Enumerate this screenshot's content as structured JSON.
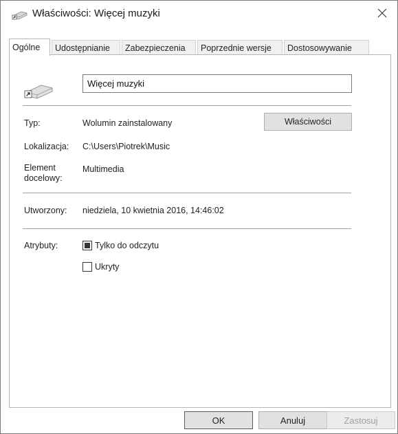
{
  "window": {
    "title": "Właściwości: Więcej muzyki",
    "close_label": "×"
  },
  "tabs": [
    {
      "label": "Ogólne",
      "active": true
    },
    {
      "label": "Udostępnianie",
      "active": false
    },
    {
      "label": "Zabezpieczenia",
      "active": false
    },
    {
      "label": "Poprzednie wersje",
      "active": false
    },
    {
      "label": "Dostosowywanie",
      "active": false
    }
  ],
  "general": {
    "name_value": "Więcej muzyki",
    "type_label": "Typ:",
    "type_value": "Wolumin zainstalowany",
    "properties_button": "Właściwości",
    "location_label": "Lokalizacja:",
    "location_value": "C:\\Users\\Piotrek\\Music",
    "target_label_line1": "Element",
    "target_label_line2": "docelowy:",
    "target_value": "Multimedia",
    "created_label": "Utworzony:",
    "created_value": "niedziela, 10 kwietnia 2016, 14:46:02",
    "attributes_label": "Atrybuty:",
    "readonly_label": "Tylko do odczytu",
    "readonly_state": "indeterminate",
    "hidden_label": "Ukryty",
    "hidden_state": "unchecked"
  },
  "footer": {
    "ok_label": "OK",
    "cancel_label": "Anuluj",
    "apply_label": "Zastosuj",
    "apply_enabled": false
  },
  "icons": {
    "title_icon": "shortcut-drive-icon",
    "item_icon": "shortcut-drive-icon",
    "close_icon": "close-icon"
  }
}
